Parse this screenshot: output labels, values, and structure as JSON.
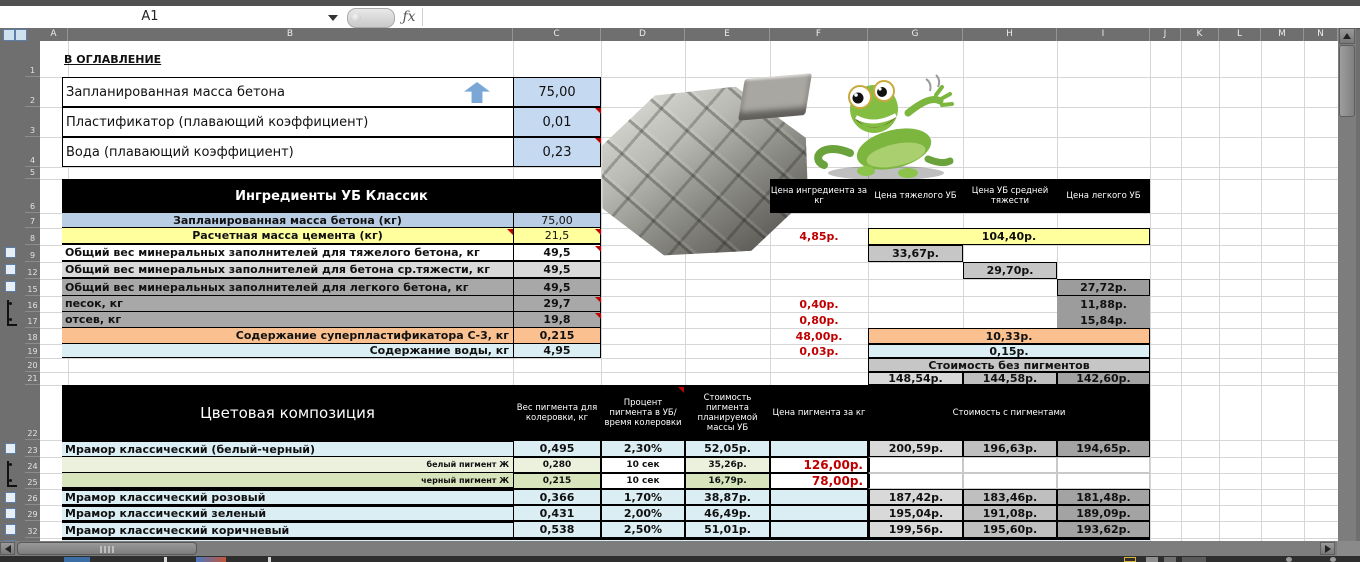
{
  "chrome": {
    "name_box": "A1",
    "fx_label": "ƒx"
  },
  "columns": {
    "letters": [
      "A",
      "B",
      "C",
      "D",
      "E",
      "F",
      "G",
      "H",
      "I",
      "J",
      "K",
      "L",
      "M",
      "N"
    ]
  },
  "row_numbers": [
    "1",
    "2",
    "3",
    "4",
    "5",
    "6",
    "7",
    "8",
    "9",
    "12",
    "15",
    "16",
    "17",
    "18",
    "19",
    "20",
    "21",
    "22",
    "23",
    "24",
    "25",
    "26",
    "29",
    "32"
  ],
  "toc_link": "В ОГЛАВЛЕНИЕ",
  "params": {
    "rows": [
      {
        "label": "Запланированная масса бетона",
        "value": "75,00"
      },
      {
        "label": "Пластификатор (плавающий коэффициент)",
        "value": "0,01"
      },
      {
        "label": "Вода (плавающий коэффициент)",
        "value": "0,23"
      }
    ]
  },
  "ingredients": {
    "title": "Ингредиенты УБ Классик",
    "col_headers": [
      "Цена ингредиента за кг",
      "Цена тяжелого УБ",
      "Цена  УБ средней тяжести",
      "Цена легкого УБ"
    ],
    "rows": [
      {
        "label": "Запланированная масса бетона (кг)",
        "c": "75,00"
      },
      {
        "label": "Расчетная масса цемента (кг)",
        "c": "21,5",
        "f": "4,85р.",
        "ghi": "104,40р."
      },
      {
        "label": "Общий вес минеральных заполнителей для тяжелого бетона, кг",
        "c": "49,5",
        "g": "33,67р."
      },
      {
        "label": "Общий вес минеральных заполнителей для бетона ср.тяжести, кг",
        "c": "49,5",
        "h": "29,70р."
      },
      {
        "label": "Общий вес минеральных заполнителей для легкого бетона, кг",
        "c": "49,5",
        "i": "27,72р."
      },
      {
        "label": "песок, кг",
        "c": "29,7",
        "f": "0,40р.",
        "i": "11,88р."
      },
      {
        "label": "отсев, кг",
        "c": "19,8",
        "f": "0,80р.",
        "i": "15,84р."
      },
      {
        "label": "Содержание суперпластификатора С-3, кг",
        "c": "0,215",
        "f": "48,00р.",
        "ghi": "10,33р."
      },
      {
        "label": "Содержание воды, кг",
        "c": "4,95",
        "f": "0,03р.",
        "ghi": "0,15р."
      },
      {
        "ghi_label": "Стоимость без пигментов"
      },
      {
        "g": "148,54р.",
        "h": "144,58р.",
        "i": "142,60р."
      }
    ]
  },
  "pigments": {
    "title": "Цветовая композиция",
    "col_headers": [
      "Вес пигмента для колеровки, кг",
      "Процент пигмента в УБ/время колеровки",
      "Стоимость пигмента планируемой массы УБ",
      "Цена пигмента за кг",
      "Стоимость с пигментами"
    ],
    "rows": [
      {
        "label": "Мрамор классический (белый-черный)",
        "c": "0,495",
        "d": "2,30%",
        "e": "52,05р.",
        "f": "",
        "g": "200,59р.",
        "h": "196,63р.",
        "i": "194,65р."
      },
      {
        "label": "белый пигмент Ж",
        "c": "0,280",
        "d": "10 сек",
        "e": "35,26р.",
        "f": "126,00р."
      },
      {
        "label": "черный пигмент Ж",
        "c": "0,215",
        "d": "10 сек",
        "e": "16,79р.",
        "f": "78,00р."
      },
      {
        "label": "Мрамор классический розовый",
        "c": "0,366",
        "d": "1,70%",
        "e": "38,87р.",
        "f": "",
        "g": "187,42р.",
        "h": "183,46р.",
        "i": "181,48р."
      },
      {
        "label": "Мрамор классический зеленый",
        "c": "0,431",
        "d": "2,00%",
        "e": "46,49р.",
        "f": "",
        "g": "195,04р.",
        "h": "191,08р.",
        "i": "189,09р."
      },
      {
        "label": "Мрамор классический коричневый",
        "c": "0,538",
        "d": "2,50%",
        "e": "51,01р.",
        "f": "",
        "g": "199,56р.",
        "h": "195,60р.",
        "i": "193,62р."
      }
    ]
  },
  "icons": {
    "up_arrow": "blue-up-arrow",
    "images": [
      "concrete-paver-octagon",
      "concrete-cube",
      "gecko-mascot"
    ]
  },
  "colors": {
    "input_blue": "#c5d9f1",
    "row_blue": "#b9cde5",
    "row_yellow": "#ffff9e",
    "row_orange": "#fac08f",
    "row_lightblue": "#daeef3",
    "row_paleblue": "#dbeef4",
    "row_palegreen": "#ebf1dd",
    "row_green2": "#d7e4bc",
    "price_red": "#c00000",
    "gray_g": "#d9d9d9",
    "gray_h": "#bfbfbf",
    "gray_i": "#a3a3a3",
    "header_black": "#000000"
  }
}
